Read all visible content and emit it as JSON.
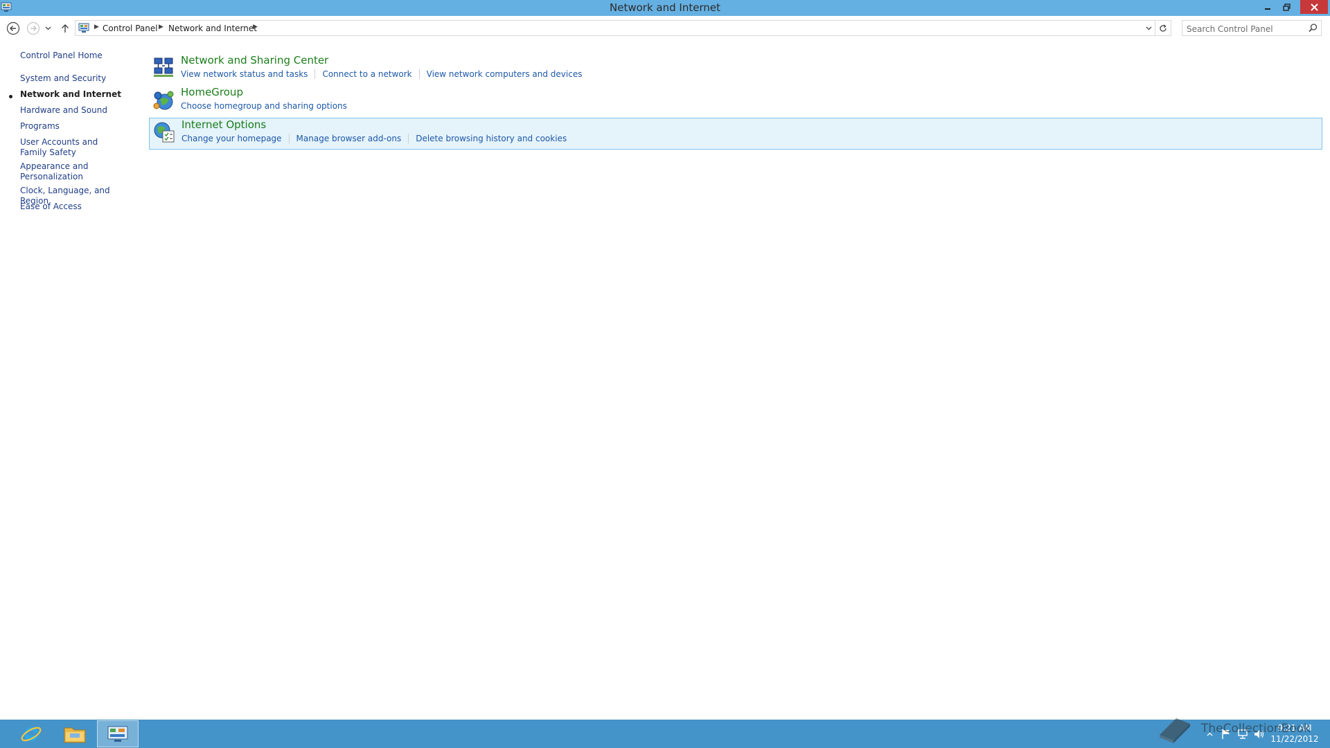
{
  "window": {
    "title": "Network and Internet"
  },
  "address_bar": {
    "breadcrumbs": [
      "Control Panel",
      "Network and Internet"
    ]
  },
  "search": {
    "placeholder": "Search Control Panel"
  },
  "left_nav": {
    "items": [
      {
        "label": "Control Panel Home",
        "active": false
      },
      {
        "label": "System and Security",
        "active": false
      },
      {
        "label": "Network and Internet",
        "active": true
      },
      {
        "label": "Hardware and Sound",
        "active": false
      },
      {
        "label": "Programs",
        "active": false
      },
      {
        "label": "User Accounts and Family Safety",
        "active": false
      },
      {
        "label": "Appearance and Personalization",
        "active": false
      },
      {
        "label": "Clock, Language, and Region",
        "active": false
      },
      {
        "label": "Ease of Access",
        "active": false
      }
    ]
  },
  "categories": [
    {
      "title": "Network and Sharing Center",
      "icon": "network-sharing-center-icon",
      "links": [
        "View network status and tasks",
        "Connect to a network",
        "View network computers and devices"
      ]
    },
    {
      "title": "HomeGroup",
      "icon": "homegroup-icon",
      "links": [
        "Choose homegroup and sharing options"
      ]
    },
    {
      "title": "Internet Options",
      "icon": "internet-options-icon",
      "highlighted": true,
      "links": [
        "Change your homepage",
        "Manage browser add-ons",
        "Delete browsing history and cookies"
      ]
    }
  ],
  "taskbar": {
    "pinned": [
      "internet-explorer-icon",
      "file-explorer-icon",
      "control-panel-icon"
    ],
    "clock_time": "9:21 AM",
    "clock_date": "11/22/2012"
  },
  "watermark": {
    "text": "TheCollectionBook"
  },
  "colors": {
    "titlebar": "#65b0e2",
    "taskbar": "#4594c9",
    "category_title": "#1a7d1a",
    "link": "#1d58a7",
    "close_button": "#c7383a",
    "highlight_bg": "#e5f3fb",
    "highlight_border": "#7ec4ea"
  }
}
